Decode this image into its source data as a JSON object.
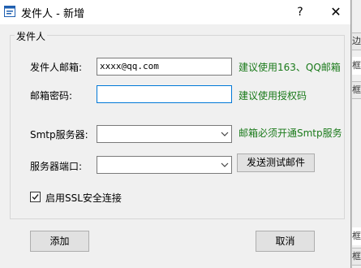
{
  "window": {
    "title": "发件人 - 新增",
    "help": "?",
    "close": "✕"
  },
  "group": {
    "title": "发件人"
  },
  "fields": {
    "email_label": "发件人邮箱:",
    "email_value": "xxxx@qq.com",
    "email_hint": "建议使用163、QQ邮箱",
    "password_label": "邮箱密码:",
    "password_value": "",
    "password_hint": "建议使用授权码",
    "smtp_label": "Smtp服务器:",
    "smtp_value": "",
    "smtp_hint": "邮箱必须开通Smtp服务",
    "port_label": "服务器端口:",
    "port_value": "",
    "test_button": "发送测试邮件"
  },
  "ssl": {
    "label": "启用SSL安全连接",
    "checked": true
  },
  "footer": {
    "add_button": "添加",
    "cancel_button": "取消"
  },
  "background_window": {
    "top_tab": "边",
    "row_labels": [
      "框",
      "框",
      "框",
      "框"
    ]
  }
}
